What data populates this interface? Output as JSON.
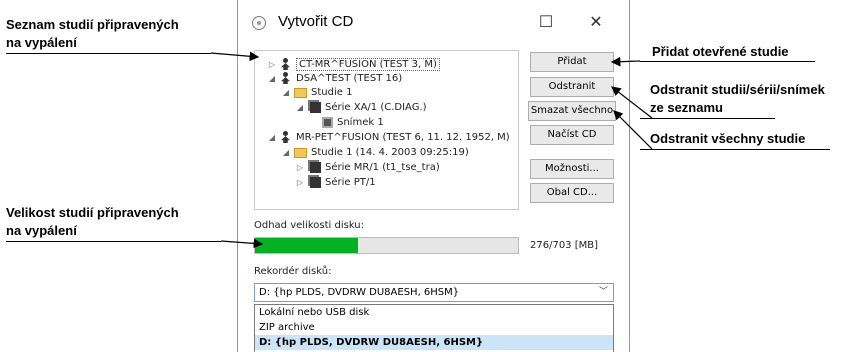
{
  "annotations": {
    "seznam": [
      "Seznam studií připravených",
      "na vypálení"
    ],
    "velikost": [
      "Velikost studií připravených",
      "na vypálení"
    ],
    "pridat": "Přidat otevřené studie",
    "odstranit": [
      "Odstranit studii/sérii/snímek",
      "ze seznamu"
    ],
    "odstranit_vse": "Odstranit všechny studie"
  },
  "dialog": {
    "title": "Vytvořit CD",
    "minimize_glyph": "☐",
    "close_glyph": "✕"
  },
  "tree": [
    {
      "label": "CT-MR^FUSION (TEST 3, M)",
      "expander": "▷",
      "icon": "person-icon"
    },
    {
      "label": "DSA^TEST (TEST 16)",
      "expander": "◢",
      "icon": "person-icon"
    },
    {
      "label": "Studie 1",
      "expander": "◢",
      "icon": "folder-icon"
    },
    {
      "label": "Série XA/1 (C.DIAG.)",
      "expander": "◢",
      "icon": "series-icon"
    },
    {
      "label": "Snímek 1",
      "expander": "",
      "icon": "image-icon"
    },
    {
      "label": "MR-PET^FUSION (TEST 6, 11. 12. 1952, M)",
      "expander": "◢",
      "icon": "person-icon"
    },
    {
      "label": "Studie 1 (14. 4. 2003 09:25:19)",
      "expander": "◢",
      "icon": "folder-icon"
    },
    {
      "label": "Série MR/1 (t1_tse_tra)",
      "expander": "▷",
      "icon": "series-icon"
    },
    {
      "label": "Série PT/1",
      "expander": "▷",
      "icon": "series-icon"
    }
  ],
  "buttons": {
    "add": "Přidat",
    "remove": "Odstranit",
    "remove_all": "Smazat všechno",
    "load": "Načíst CD",
    "options": "Možnosti...",
    "cover": "Obal CD..."
  },
  "size": {
    "label": "Odhad velikosti disku:",
    "used": 276,
    "total": 703,
    "text": "276/703 [MB]",
    "fill_color": "#06b025"
  },
  "recorder": {
    "label": "Rekordér disků:",
    "selected": "D: {hp PLDS, DVDRW  DU8AESH, 6HSM}",
    "options": [
      "Lokální nebo USB disk",
      "ZIP archive",
      "D: {hp PLDS, DVDRW  DU8AESH, 6HSM}"
    ]
  }
}
